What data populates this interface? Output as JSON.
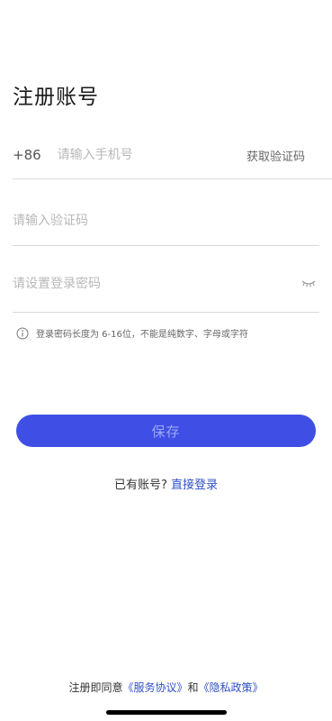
{
  "page": {
    "title": "注册账号"
  },
  "phone": {
    "prefix": "+86",
    "placeholder": "请输入手机号",
    "get_code_label": "获取验证码"
  },
  "code": {
    "placeholder": "请输入验证码"
  },
  "password": {
    "placeholder": "请设置登录密码",
    "visibility_icon": "eye-closed-icon"
  },
  "hint": {
    "icon": "info-icon",
    "text": "登录密码长度为 6-16位，不能是纯数字、字母或字符"
  },
  "save_button": {
    "label": "保存",
    "color": "#3f4fe6"
  },
  "login": {
    "prompt": "已有账号?",
    "link_label": "直接登录"
  },
  "agreement": {
    "prefix": "注册即同意",
    "service_link": "《服务协议》",
    "conjunction": "和",
    "privacy_link": "《隐私政策》"
  },
  "colors": {
    "link": "#3050c8",
    "divider": "#d9d9d9"
  }
}
